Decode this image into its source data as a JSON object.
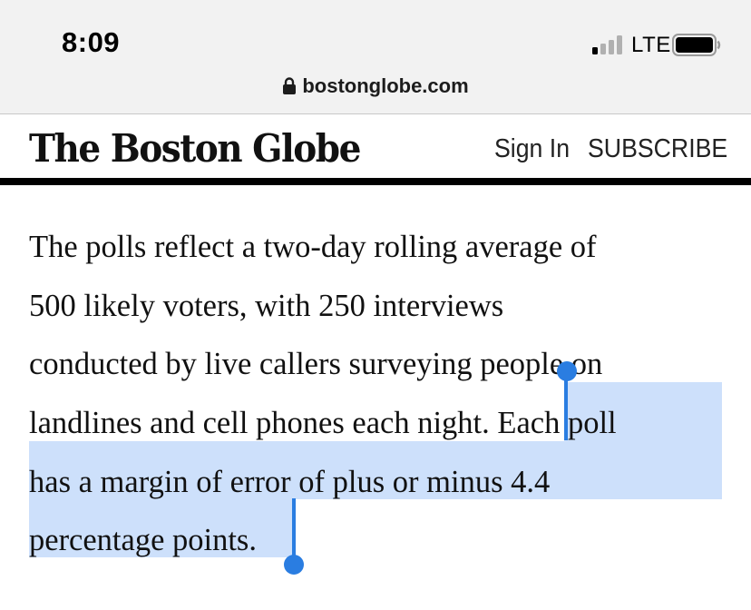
{
  "status_bar": {
    "time": "8:09",
    "network": "LTE",
    "signal_bars_filled": 1,
    "signal_bars_total": 4
  },
  "browser": {
    "url": "bostonglobe.com",
    "lock_icon": "lock-icon"
  },
  "site_header": {
    "logo": "The Boston Globe",
    "sign_in": "Sign In",
    "subscribe": "SUBSCRIBE"
  },
  "article": {
    "lines": [
      "The polls reflect a two-day rolling average of",
      "500 likely voters, with 250 interviews",
      "conducted by live callers surveying people on",
      "landlines and cell phones each night.",
      "has a margin of error of plus or minus 4.4",
      "percentage points."
    ],
    "selected_fragment_line4": "Each poll"
  },
  "colors": {
    "selection_highlight": "#cde0fb",
    "selection_handle": "#2a7de1",
    "chrome_background": "#f2f2f2"
  }
}
